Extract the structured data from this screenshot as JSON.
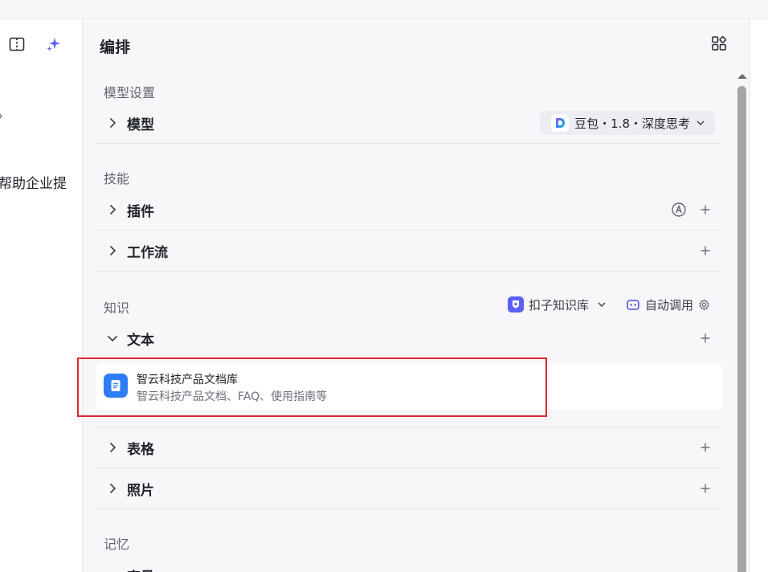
{
  "left_pane": {
    "snippet_punct": "。",
    "snippet_text": "帮助企业提"
  },
  "editor": {
    "title": "编排"
  },
  "sections": {
    "model_settings": "模型设置",
    "skills": "技能",
    "knowledge": "知识",
    "memory": "记忆"
  },
  "model": {
    "row_label": "模型",
    "selected": "豆包・1.8・深度思考"
  },
  "skills": {
    "plugins_label": "插件",
    "workflow_label": "工作流"
  },
  "knowledge": {
    "kb_source": "扣子知识库",
    "auto_call": "自动调用",
    "text_label": "文本",
    "table_label": "表格",
    "photo_label": "照片",
    "kb_item": {
      "title": "智云科技产品文档库",
      "description": "智云科技产品文档、FAQ、使用指南等"
    }
  },
  "memory": {
    "partial_label": "变量"
  },
  "colors": {
    "accent": "#5b5ff6",
    "highlight": "#e0262c",
    "kb_icon": "#2f7cf6"
  }
}
